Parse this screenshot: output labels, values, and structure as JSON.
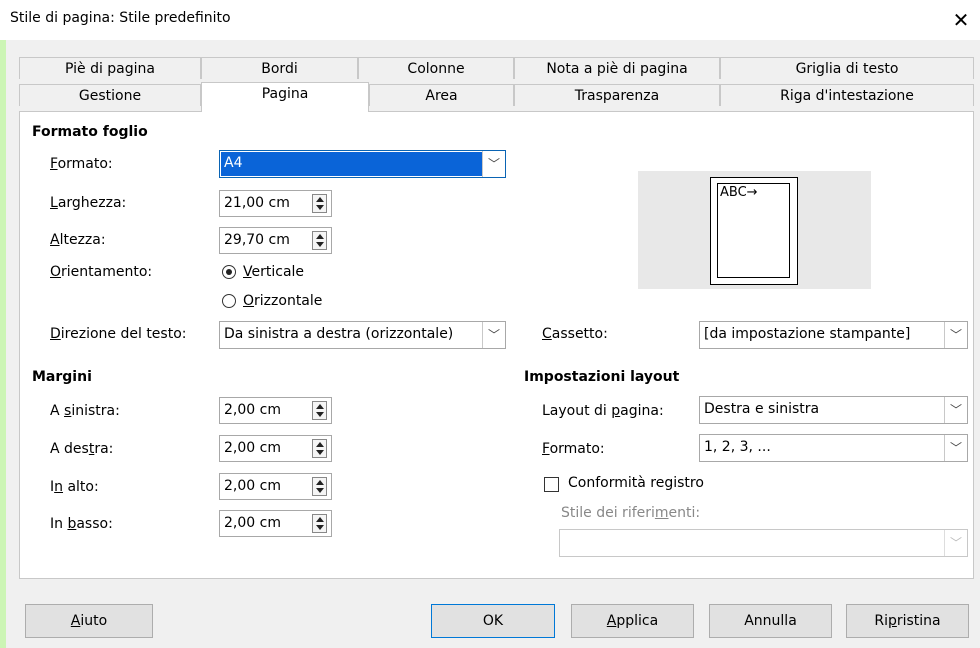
{
  "window": {
    "title": "Stile di pagina: Stile predefinito",
    "close_glyph": "✕"
  },
  "tabs_row1": [
    "Piè di pagina",
    "Bordi",
    "Colonne",
    "Nota a piè di pagina",
    "Griglia di testo"
  ],
  "tabs_row2": [
    "Gestione",
    "Pagina",
    "Area",
    "Trasparenza",
    "Riga d'intestazione"
  ],
  "active_tab": "Pagina",
  "formato_foglio": {
    "heading": "Formato foglio",
    "formato_label_u": "F",
    "formato_label_rest": "ormato:",
    "formato_value": "A4",
    "larghezza_label_u": "L",
    "larghezza_label_rest": "arghezza:",
    "larghezza_value": "21,00 cm",
    "altezza_label_u": "A",
    "altezza_label_rest": "ltezza:",
    "altezza_value": "29,70 cm",
    "orientamento_label_u": "O",
    "orientamento_label_rest": "rientamento:",
    "verticale_u": "V",
    "verticale_rest": "erticale",
    "orizzontale_u": "O",
    "orizzontale_rest": "rizzontale",
    "orientation_selected": "Verticale",
    "direzione_label_u": "D",
    "direzione_label_rest": "irezione del testo:",
    "direzione_value": "Da sinistra a destra (orizzontale)",
    "cassetto_label_u": "C",
    "cassetto_label_rest": "assetto:",
    "cassetto_value": "[da impostazione stampante]",
    "preview_text": "ABC→"
  },
  "margini": {
    "heading": "Margini",
    "sinistra_pre": "A ",
    "sinistra_u": "s",
    "sinistra_rest": "inistra:",
    "sinistra_value": "2,00 cm",
    "destra_pre": "A des",
    "destra_u": "t",
    "destra_rest": "ra:",
    "destra_value": "2,00 cm",
    "alto_pre": "I",
    "alto_u": "n",
    "alto_rest": " alto:",
    "alto_value": "2,00 cm",
    "basso_pre": "In ",
    "basso_u": "b",
    "basso_rest": "asso:",
    "basso_value": "2,00 cm"
  },
  "layout": {
    "heading": "Impostazioni layout",
    "layout_label_pre": "Layout di ",
    "layout_label_u": "p",
    "layout_label_rest": "agina:",
    "layout_value": "Destra e sinistra",
    "formato_label_u": "F",
    "formato_label_rest": "ormato:",
    "formato_value": "1, 2, 3, ...",
    "conformita_label": "Conformità registro",
    "conformita_checked": false,
    "stile_label_pre": "Stile dei riferi",
    "stile_label_u": "m",
    "stile_label_rest": "enti:",
    "stile_value": ""
  },
  "buttons": {
    "aiuto_u": "A",
    "aiuto_rest": "iuto",
    "ok": "OK",
    "applica_u": "A",
    "applica_rest": "pplica",
    "annulla": "Annulla",
    "ripristina_pre": "Ri",
    "ripristina_u": "p",
    "ripristina_rest": "ristina"
  }
}
